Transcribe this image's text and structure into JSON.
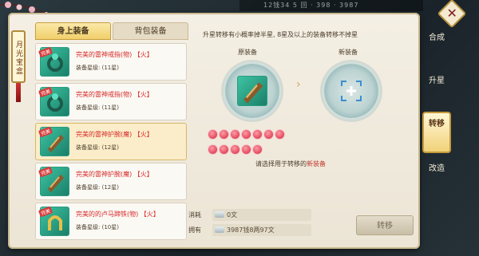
{
  "top_status": "12钱34 5 回 · 398 · 3987",
  "side_tag": "月光宝盒",
  "tabs": [
    {
      "label": "身上装备",
      "active": true
    },
    {
      "label": "背包装备",
      "active": false
    }
  ],
  "items": [
    {
      "name": "完美的雷神戒指(物) 【火】",
      "level": "装备星级: (11星)",
      "badge": "完美",
      "icon": "ring-icon",
      "selected": false
    },
    {
      "name": "完美的雷神戒指(物) 【火】",
      "level": "装备星级: (11星)",
      "badge": "完美",
      "icon": "ring-icon",
      "selected": false
    },
    {
      "name": "完美的雷神护腕(魔) 【火】",
      "level": "装备星级: (12星)",
      "badge": "完美",
      "icon": "bracer-icon",
      "selected": true
    },
    {
      "name": "完美的雷神护腕(魔) 【火】",
      "level": "装备星级: (12星)",
      "badge": "完美",
      "icon": "bracer-icon",
      "selected": false
    },
    {
      "name": "完美的的卢马蹄铁(物) 【火】",
      "level": "装备星级: (10星)",
      "badge": "完美",
      "icon": "horseshoe-icon",
      "selected": false
    }
  ],
  "main": {
    "hint": "升星转移有小概率掉半星, 8星及以上的装备转移不掉星",
    "origin_label": "原装备",
    "new_label": "新装备",
    "star_count": 12,
    "prompt_prefix": "请选择用于转移的",
    "prompt_highlight": "新装备"
  },
  "cost": {
    "consume_label": "消耗",
    "consume_value": "0文",
    "own_label": "拥有",
    "own_value": "3987钱8两97文"
  },
  "transfer_button": "转移",
  "right_nav": [
    {
      "label": "合成",
      "active": false
    },
    {
      "label": "升星",
      "active": false
    },
    {
      "label": "转移",
      "active": true
    },
    {
      "label": "改造",
      "active": false
    }
  ],
  "colors": {
    "accent": "#f1cf6b",
    "item_name": "#d62b2b",
    "highlight": "#c0392b",
    "star": "#e14a5b"
  }
}
